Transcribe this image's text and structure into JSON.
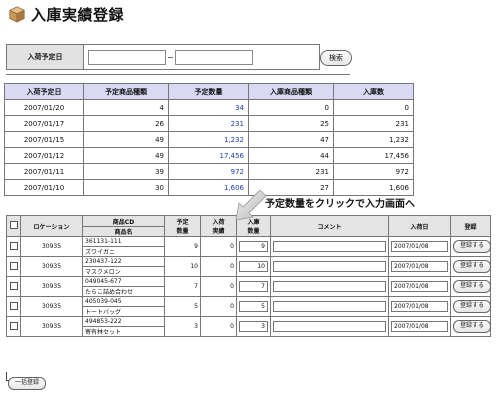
{
  "title": "入庫実績登録",
  "search": {
    "label": "入荷予定日",
    "from_value": "",
    "to_value": "",
    "separator": "~",
    "button_label": "検索"
  },
  "summary": {
    "headers": [
      "入荷予定日",
      "予定商品種類",
      "予定数量",
      "入庫商品種類",
      "入庫数"
    ],
    "rows": [
      [
        "2007/01/20",
        "4",
        "34",
        "0",
        "0"
      ],
      [
        "2007/01/17",
        "26",
        "231",
        "25",
        "231"
      ],
      [
        "2007/01/15",
        "49",
        "1,232",
        "47",
        "1,232"
      ],
      [
        "2007/01/12",
        "49",
        "17,456",
        "44",
        "17,456"
      ],
      [
        "2007/01/11",
        "39",
        "972",
        "231",
        "972"
      ],
      [
        "2007/01/10",
        "30",
        "1,606",
        "27",
        "1,606"
      ]
    ]
  },
  "annotation": "予定数量をクリックで入力画面へ",
  "detail": {
    "headers": {
      "location": "ロケーション",
      "product_cd": "商品CD",
      "product_name": "商品名",
      "planned_qty": "予定\n数量",
      "received": "入荷\n実績",
      "received_qty": "入庫\n数量",
      "comment": "コメント",
      "date": "入荷日",
      "register": "登録"
    },
    "rows": [
      {
        "location": "30935",
        "code": "361131-111",
        "name": "ズワイガニ",
        "planned": "9",
        "actual": "0",
        "qty": "9",
        "comment": "",
        "date": "2007/01/08",
        "button": "登録する"
      },
      {
        "location": "30935",
        "code": "230437-122",
        "name": "マスクメロン",
        "planned": "10",
        "actual": "0",
        "qty": "10",
        "comment": "",
        "date": "2007/01/08",
        "button": "登録する"
      },
      {
        "location": "30935",
        "code": "049045-677",
        "name": "たらこ詰め合わせ",
        "planned": "7",
        "actual": "0",
        "qty": "7",
        "comment": "",
        "date": "2007/01/08",
        "button": "登録する"
      },
      {
        "location": "30935",
        "code": "405039-045",
        "name": "トートバッグ",
        "planned": "5",
        "actual": "0",
        "qty": "5",
        "comment": "",
        "date": "2007/01/08",
        "button": "登録する"
      },
      {
        "location": "30935",
        "code": "494853-222",
        "name": "寄有林セット",
        "planned": "3",
        "actual": "0",
        "qty": "3",
        "comment": "",
        "date": "2007/01/08",
        "button": "登録する"
      }
    ]
  },
  "bulk_button": "一括登録",
  "colors": {
    "header_bg": "#d9d9f4",
    "link": "#1a3ab8",
    "box_icon": "#c9975a"
  }
}
